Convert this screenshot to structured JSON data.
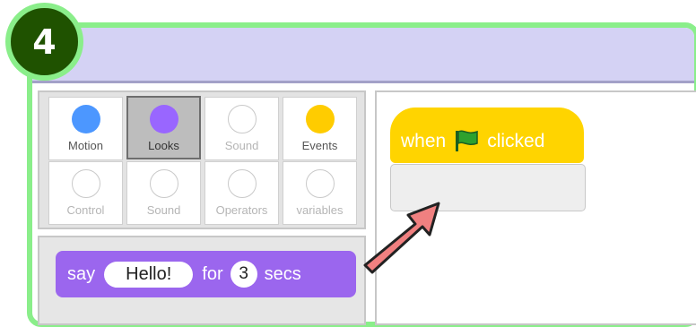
{
  "step_badge": "4",
  "categories": [
    {
      "label": "Motion",
      "color": "#4c97ff",
      "active": true,
      "selected": false
    },
    {
      "label": "Looks",
      "color": "#9966ff",
      "active": true,
      "selected": true
    },
    {
      "label": "Sound",
      "color": null,
      "active": false,
      "selected": false
    },
    {
      "label": "Events",
      "color": "#ffcc00",
      "active": true,
      "selected": false
    },
    {
      "label": "Control",
      "color": null,
      "active": false,
      "selected": false
    },
    {
      "label": "Sound",
      "color": null,
      "active": false,
      "selected": false
    },
    {
      "label": "Operators",
      "color": null,
      "active": false,
      "selected": false
    },
    {
      "label": "variables",
      "color": null,
      "active": false,
      "selected": false
    }
  ],
  "say_block": {
    "say": "say",
    "message": "Hello!",
    "for": "for",
    "duration": "3",
    "secs": "secs",
    "color": "#9b66ee"
  },
  "hat_block": {
    "when": "when",
    "clicked": "clicked",
    "color": "#ffd400",
    "flag_icon": "green-flag-icon"
  },
  "arrow_color": "#f08080"
}
